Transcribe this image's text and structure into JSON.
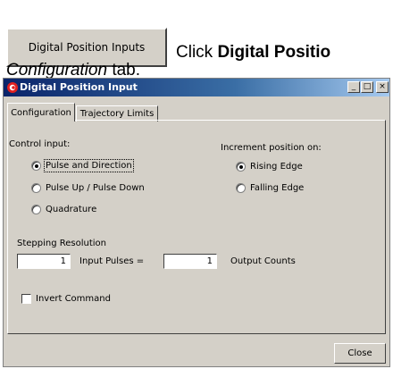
{
  "doc": {
    "button_label": "Digital Position Inputs",
    "line1_prefix": "Click",
    "line1_bold": "Digital Positio",
    "line2_italic": "Configuration",
    "line2_suffix": "tab."
  },
  "window": {
    "title": "Digital Position Input",
    "icon": "app-logo-icon",
    "controls": [
      "_",
      "□",
      "×"
    ]
  },
  "tabs": [
    {
      "label": "Configuration",
      "active": true
    },
    {
      "label": "Trajectory Limits",
      "active": false
    }
  ],
  "control_input": {
    "heading": "Control input:",
    "options": [
      {
        "label": "Pulse and Direction",
        "selected": true
      },
      {
        "label": "Pulse Up / Pulse Down",
        "selected": false
      },
      {
        "label": "Quadrature",
        "selected": false
      }
    ]
  },
  "increment": {
    "heading": "Increment position on:",
    "options": [
      {
        "label": "Rising Edge",
        "selected": true
      },
      {
        "label": "Falling Edge",
        "selected": false
      }
    ]
  },
  "stepping": {
    "heading": "Stepping Resolution",
    "input_pulses_value": "1",
    "input_pulses_label": "Input Pulses =",
    "output_counts_value": "1",
    "output_counts_label": "Output Counts"
  },
  "invert": {
    "label": "Invert Command",
    "checked": false
  },
  "close_label": "Close"
}
